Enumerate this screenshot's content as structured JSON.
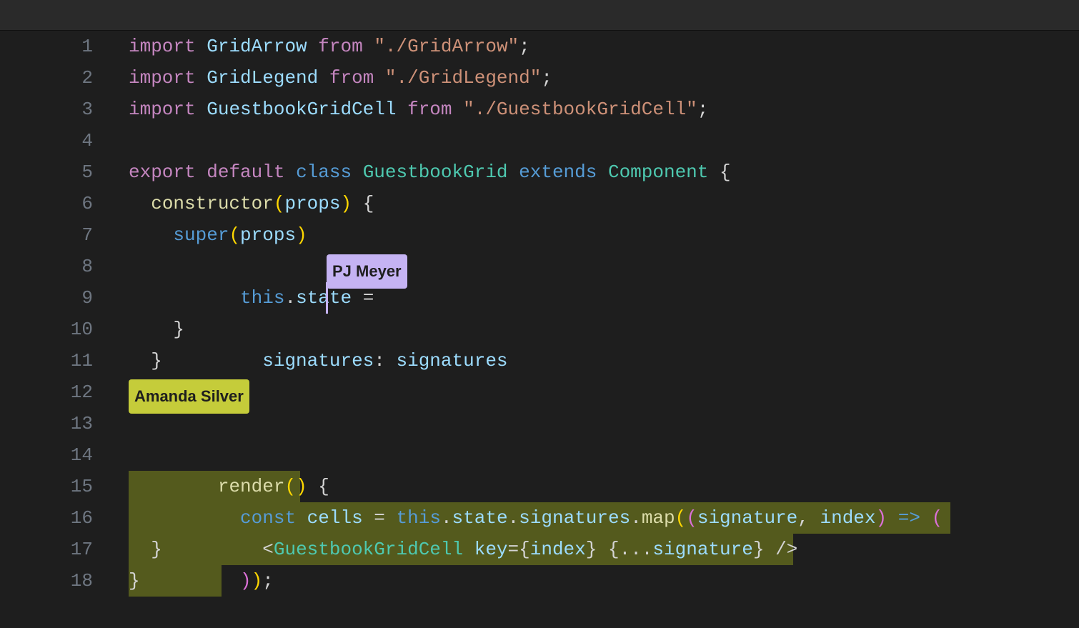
{
  "editor": {
    "line_numbers": [
      "1",
      "2",
      "3",
      "4",
      "5",
      "6",
      "7",
      "8",
      "9",
      "10",
      "11",
      "12",
      "13",
      "14",
      "15",
      "16",
      "17",
      "18"
    ],
    "collaborators": {
      "pj": {
        "name": "PJ Meyer",
        "color": "#c5b3f3"
      },
      "amanda": {
        "name": "Amanda Silver",
        "color": "#c5cc3a"
      }
    },
    "code": {
      "l1": {
        "kw": "import",
        "id": "GridArrow",
        "from": "from",
        "path": "\"./GridArrow\"",
        "semi": ";"
      },
      "l2": {
        "kw": "import",
        "id": "GridLegend",
        "from": "from",
        "path": "\"./GridLegend\"",
        "semi": ";"
      },
      "l3": {
        "kw": "import",
        "id": "GuestbookGridCell",
        "from": "from",
        "path": "\"./GuestbookGridCell\"",
        "semi": ";"
      },
      "l5": {
        "export": "export",
        "default": "default",
        "class": "class",
        "name": "GuestbookGrid",
        "extends": "extends",
        "super": "Component",
        "brace": "{"
      },
      "l6": {
        "ctor": "constructor",
        "lp": "(",
        "arg": "props",
        "rp": ")",
        "brace": "{"
      },
      "l7": {
        "super": "super",
        "lp": "(",
        "arg": "props",
        "rp": ")"
      },
      "l8": {
        "this": "this",
        "dot": ".",
        "state": "state",
        "eq": " ="
      },
      "l9": {
        "key": "signatures",
        "colon": ":",
        "val": "signatures"
      },
      "l10": {
        "brace": "}"
      },
      "l11": {
        "brace": "}"
      },
      "l13": {
        "fn": "render",
        "lp": "(",
        "rp": ")",
        "brace": "{"
      },
      "l14": {
        "const": "const",
        "id": "cells",
        "eq": "=",
        "this": "this",
        "d1": ".",
        "state": "state",
        "d2": ".",
        "sig": "signatures",
        "d3": ".",
        "map": "map",
        "lp": "(",
        "lp2": "(",
        "a1": "signature",
        "comma": ",",
        "a2": "index",
        "rp2": ")",
        "arrow": "=>",
        "lp3": "("
      },
      "l15": {
        "lt": "<",
        "tag": "GuestbookGridCell",
        "key": "key",
        "eq": "=",
        "lb": "{",
        "idx": "index",
        "rb": "}",
        "lb2": "{",
        "spread": "...",
        "sig": "signature",
        "rb2": "}",
        "close": "/>"
      },
      "l16": {
        "rp": ")",
        "rp2": ")",
        "semi": ";"
      },
      "l17": {
        "brace": "}"
      },
      "l18": {
        "brace": "}"
      }
    }
  }
}
